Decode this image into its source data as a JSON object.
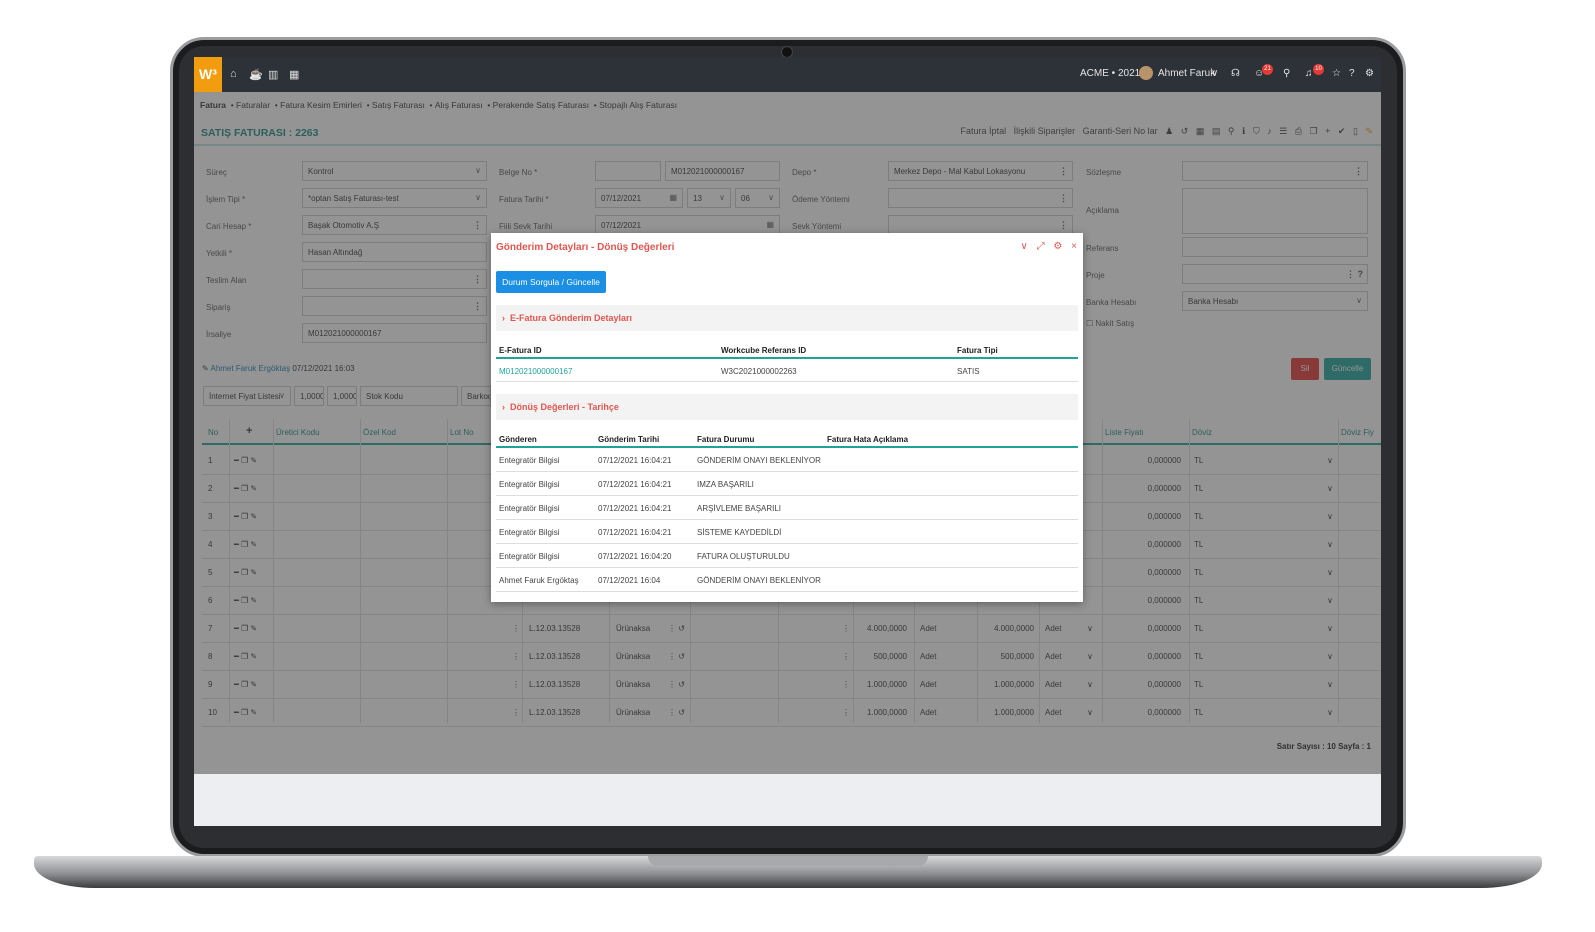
{
  "app": {
    "logo": "W³",
    "company": "ACME • 2021",
    "user_name": "Ahmet Faruk",
    "chat_badge": "21",
    "notif_badge": "10"
  },
  "breadcrumb": {
    "root": "Fatura",
    "items": [
      "Faturalar",
      "Fatura Kesim Emirleri",
      "Satış Faturası",
      "Alış Faturası",
      "Perakende Satış Faturası",
      "Stopajlı Alış Faturası"
    ]
  },
  "page": {
    "title": "SATIŞ FATURASI : 2263",
    "actions": [
      "Fatura İptal",
      "İlişkili Siparişler",
      "Garanti-Seri No lar"
    ]
  },
  "form": {
    "surec_label": "Süreç",
    "surec_value": "Kontrol",
    "islem_label": "İşlem Tipi *",
    "islem_value": "*optan Satış Faturası-test",
    "cari_label": "Cari Hesap *",
    "cari_value": "Başak Otomotiv A.Ş",
    "yetkili_label": "Yetkili *",
    "yetkili_value": "Hasan Altındağ",
    "teslim_label": "Teslim Alan",
    "teslim_value": "",
    "siparis_label": "Sipariş",
    "siparis_value": "",
    "irsaliye_label": "İrsaliye",
    "irsaliye_value": "M012021000000167",
    "belge_label": "Belge No *",
    "belge_prefix": "",
    "belge_value": "M012021000000167",
    "fatura_tarihi_label": "Fatura Tarihi *",
    "fatura_tarihi_value": "07/12/2021",
    "hour": "13",
    "minute": "06",
    "sevk_tarihi_label": "Fiili Sevk Tarihi",
    "sevk_tarihi_value": "07/12/2021",
    "depo_label": "Depo *",
    "depo_value": "Merkez Depo - Mal Kabul Lokasyonu",
    "odeme_label": "Ödeme Yöntemi",
    "odeme_value": "",
    "sevk_yontemi_label": "Sevk Yöntemi",
    "sevk_yontemi_value": "",
    "sozlesme_label": "Sözleşme",
    "sozlesme_value": "",
    "aciklama_label": "Açıklama",
    "aciklama_value": "",
    "referans_label": "Referans",
    "referans_value": "",
    "proje_label": "Proje",
    "proje_value": "",
    "banka_label": "Banka Hesabı",
    "banka_value": "Banka Hesabı",
    "nakit_label": "Nakit Satış"
  },
  "record": {
    "author": "Ahmet Faruk Ergöktaş",
    "timestamp": "07/12/2021 16:03",
    "delete_label": "Sil",
    "update_label": "Güncelle"
  },
  "toolbar_row": {
    "price_list": "İnternet Fiyat Listesi",
    "rate1": "1,0000",
    "rate2": "1,0000",
    "stock_code": "Stok Kodu",
    "barcode": "Barkod"
  },
  "grid": {
    "headers": {
      "no": "No",
      "plus": "+",
      "uretici": "Üretici Kodu",
      "ozel": "Özel Kod",
      "lot": "Lot No",
      "liste_fiyati": "Liste Fiyatı",
      "doviz": "Döviz",
      "doviz_fiyat": "Döviz Fiy"
    },
    "rows": [
      {
        "no": "1",
        "code": "",
        "product": "",
        "qty": "",
        "unit": "",
        "qty2": "",
        "unit2": "",
        "price": "0,000000",
        "currency": "TL"
      },
      {
        "no": "2",
        "code": "",
        "product": "",
        "qty": "",
        "unit": "",
        "qty2": "",
        "unit2": "",
        "price": "0,000000",
        "currency": "TL"
      },
      {
        "no": "3",
        "code": "",
        "product": "",
        "qty": "",
        "unit": "",
        "qty2": "",
        "unit2": "",
        "price": "0,000000",
        "currency": "TL"
      },
      {
        "no": "4",
        "code": "",
        "product": "",
        "qty": "",
        "unit": "",
        "qty2": "",
        "unit2": "",
        "price": "0,000000",
        "currency": "TL"
      },
      {
        "no": "5",
        "code": "",
        "product": "",
        "qty": "",
        "unit": "",
        "qty2": "",
        "unit2": "",
        "price": "0,000000",
        "currency": "TL"
      },
      {
        "no": "6",
        "code": "",
        "product": "",
        "qty": "",
        "unit": "",
        "qty2": "",
        "unit2": "",
        "price": "0,000000",
        "currency": "TL"
      },
      {
        "no": "7",
        "code": "L.12.03.13528",
        "product": "Ürünaksa",
        "qty": "4.000,0000",
        "unit": "Adet",
        "qty2": "4.000,0000",
        "unit2": "Adet",
        "price": "0,000000",
        "currency": "TL"
      },
      {
        "no": "8",
        "code": "L.12.03.13528",
        "product": "Ürünaksa",
        "qty": "500,0000",
        "unit": "Adet",
        "qty2": "500,0000",
        "unit2": "Adet",
        "price": "0,000000",
        "currency": "TL"
      },
      {
        "no": "9",
        "code": "L.12.03.13528",
        "product": "Ürünaksa",
        "qty": "1.000,0000",
        "unit": "Adet",
        "qty2": "1.000,0000",
        "unit2": "Adet",
        "price": "0,000000",
        "currency": "TL"
      },
      {
        "no": "10",
        "code": "L.12.03.13528",
        "product": "Ürünaksa",
        "qty": "1.000,0000",
        "unit": "Adet",
        "qty2": "1.000,0000",
        "unit2": "Adet",
        "price": "0,000000",
        "currency": "TL"
      }
    ],
    "footer": "Satır Sayısı : 10 Sayfa : 1"
  },
  "modal": {
    "title": "Gönderim Detayları - Dönüş Değerleri",
    "query_button": "Durum Sorgula / Güncelle",
    "section1": "E-Fatura Gönderim Detayları",
    "efatura_headers": [
      "E-Fatura ID",
      "Workcube Referans ID",
      "Fatura Tipi"
    ],
    "efatura_row": {
      "id": "M012021000000167",
      "ref": "W3C2021000002263",
      "type": "SATIS"
    },
    "section2": "Dönüş Değerleri - Tarihçe",
    "history_headers": [
      "Gönderen",
      "Gönderim Tarihi",
      "Fatura Durumu",
      "Fatura Hata Açıklama"
    ],
    "history_rows": [
      {
        "sender": "Entegratör Bilgisi",
        "date": "07/12/2021 16:04:21",
        "status": "GÖNDERİM ONAYI BEKLENİYOR"
      },
      {
        "sender": "Entegratör Bilgisi",
        "date": "07/12/2021 16:04:21",
        "status": "IMZA BAŞARILI"
      },
      {
        "sender": "Entegratör Bilgisi",
        "date": "07/12/2021 16:04:21",
        "status": "ARŞİVLEME BAŞARILI"
      },
      {
        "sender": "Entegratör Bilgisi",
        "date": "07/12/2021 16:04:21",
        "status": "SİSTEME KAYDEDİLDİ"
      },
      {
        "sender": "Entegratör Bilgisi",
        "date": "07/12/2021 16:04:20",
        "status": "FATURA OLUŞTURULDU"
      },
      {
        "sender": "Ahmet Faruk Ergöktaş",
        "date": "07/12/2021 16:04",
        "status": "GÖNDERİM ONAYI BEKLENİYOR"
      }
    ]
  }
}
